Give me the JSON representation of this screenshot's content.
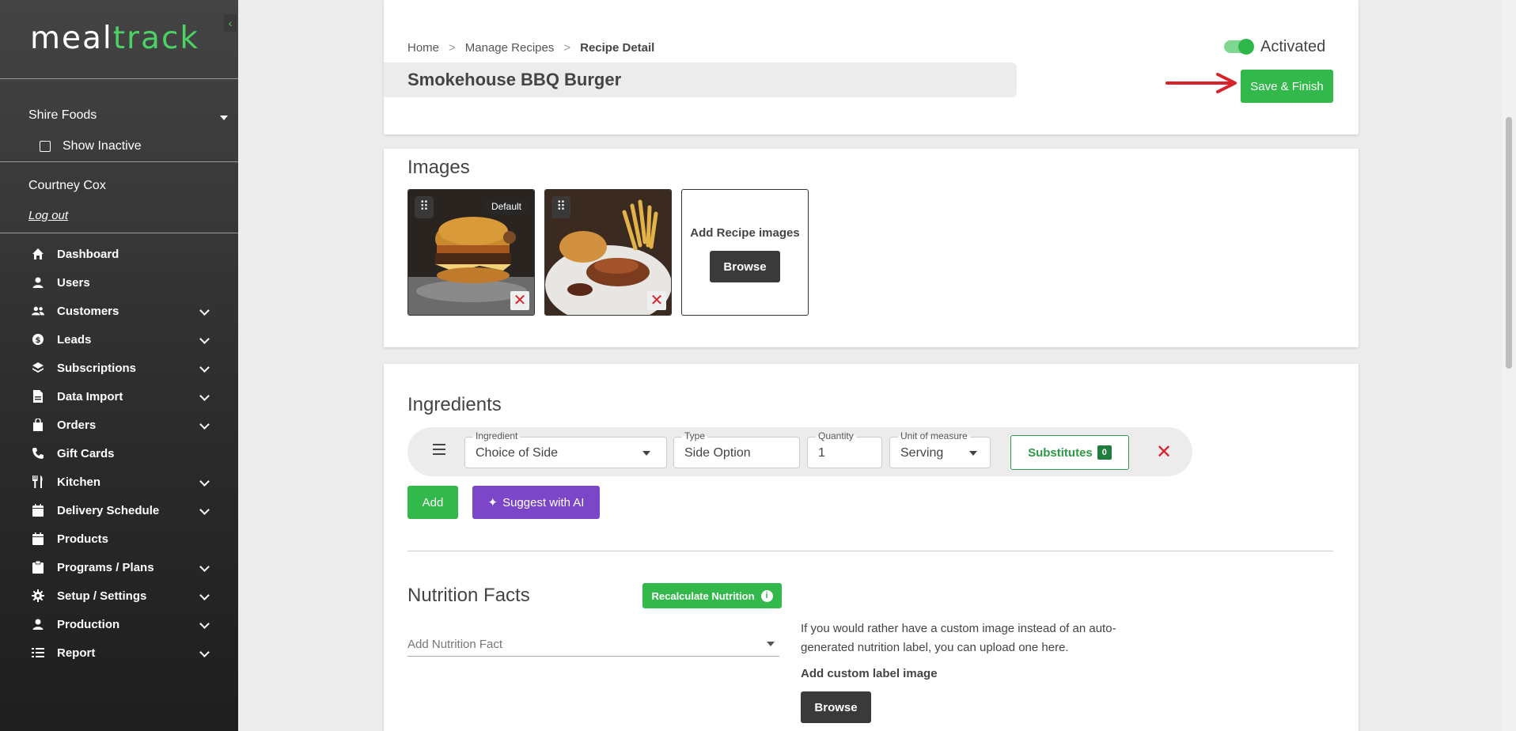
{
  "app": {
    "logo_part1": "meal",
    "logo_part2": "track"
  },
  "sidebar": {
    "org_name": "Shire Foods",
    "show_inactive_label": "Show Inactive",
    "user_name": "Courtney Cox",
    "logout_label": "Log out",
    "items": [
      {
        "label": "Dashboard",
        "icon": "home-icon",
        "expandable": false
      },
      {
        "label": "Users",
        "icon": "user-icon",
        "expandable": false
      },
      {
        "label": "Customers",
        "icon": "users-icon",
        "expandable": true
      },
      {
        "label": "Leads",
        "icon": "dollar-circle-icon",
        "expandable": true
      },
      {
        "label": "Subscriptions",
        "icon": "layers-icon",
        "expandable": true
      },
      {
        "label": "Data Import",
        "icon": "file-icon",
        "expandable": true
      },
      {
        "label": "Orders",
        "icon": "shopping-bag-icon",
        "expandable": true
      },
      {
        "label": "Gift Cards",
        "icon": "phone-icon",
        "expandable": false
      },
      {
        "label": "Kitchen",
        "icon": "utensils-icon",
        "expandable": true
      },
      {
        "label": "Delivery Schedule",
        "icon": "calendar-icon",
        "expandable": true
      },
      {
        "label": "Products",
        "icon": "calendar-icon",
        "expandable": false
      },
      {
        "label": "Programs / Plans",
        "icon": "clipboard-icon",
        "expandable": true
      },
      {
        "label": "Setup / Settings",
        "icon": "gear-icon",
        "expandable": true
      },
      {
        "label": "Production",
        "icon": "user-icon",
        "expandable": true
      },
      {
        "label": "Report",
        "icon": "list-icon",
        "expandable": true
      }
    ]
  },
  "header": {
    "breadcrumb": [
      "Home",
      "Manage Recipes",
      "Recipe Detail"
    ],
    "breadcrumb_sep": ">",
    "recipe_title": "Smokehouse BBQ Burger",
    "status_label": "Activated",
    "status_active": true,
    "save_label": "Save & Finish"
  },
  "images": {
    "title": "Images",
    "default_tag": "Default",
    "add_label": "Add Recipe images",
    "browse_label": "Browse"
  },
  "ingredients": {
    "title": "Ingredients",
    "row": {
      "ingredient_label": "Ingredient",
      "ingredient_value": "Choice of Side",
      "type_label": "Type",
      "type_value": "Side Option",
      "quantity_label": "Quantity",
      "quantity_value": "1",
      "unit_label": "Unit of measure",
      "unit_value": "Serving",
      "substitutes_label": "Substitutes",
      "substitutes_count": "0"
    },
    "add_label": "Add",
    "ai_label": "Suggest with AI"
  },
  "nutrition": {
    "title": "Nutrition Facts",
    "recalc_label": "Recalculate Nutrition",
    "add_placeholder": "Add Nutrition Fact",
    "custom_text": "If you would rather have a custom image instead of an auto-generated nutrition label, you can upload one here.",
    "custom_label": "Add custom label image",
    "browse_label": "Browse"
  },
  "colors": {
    "accent_green": "#33b84b",
    "ai_purple": "#7b47c8",
    "danger_red": "#d8232a"
  }
}
